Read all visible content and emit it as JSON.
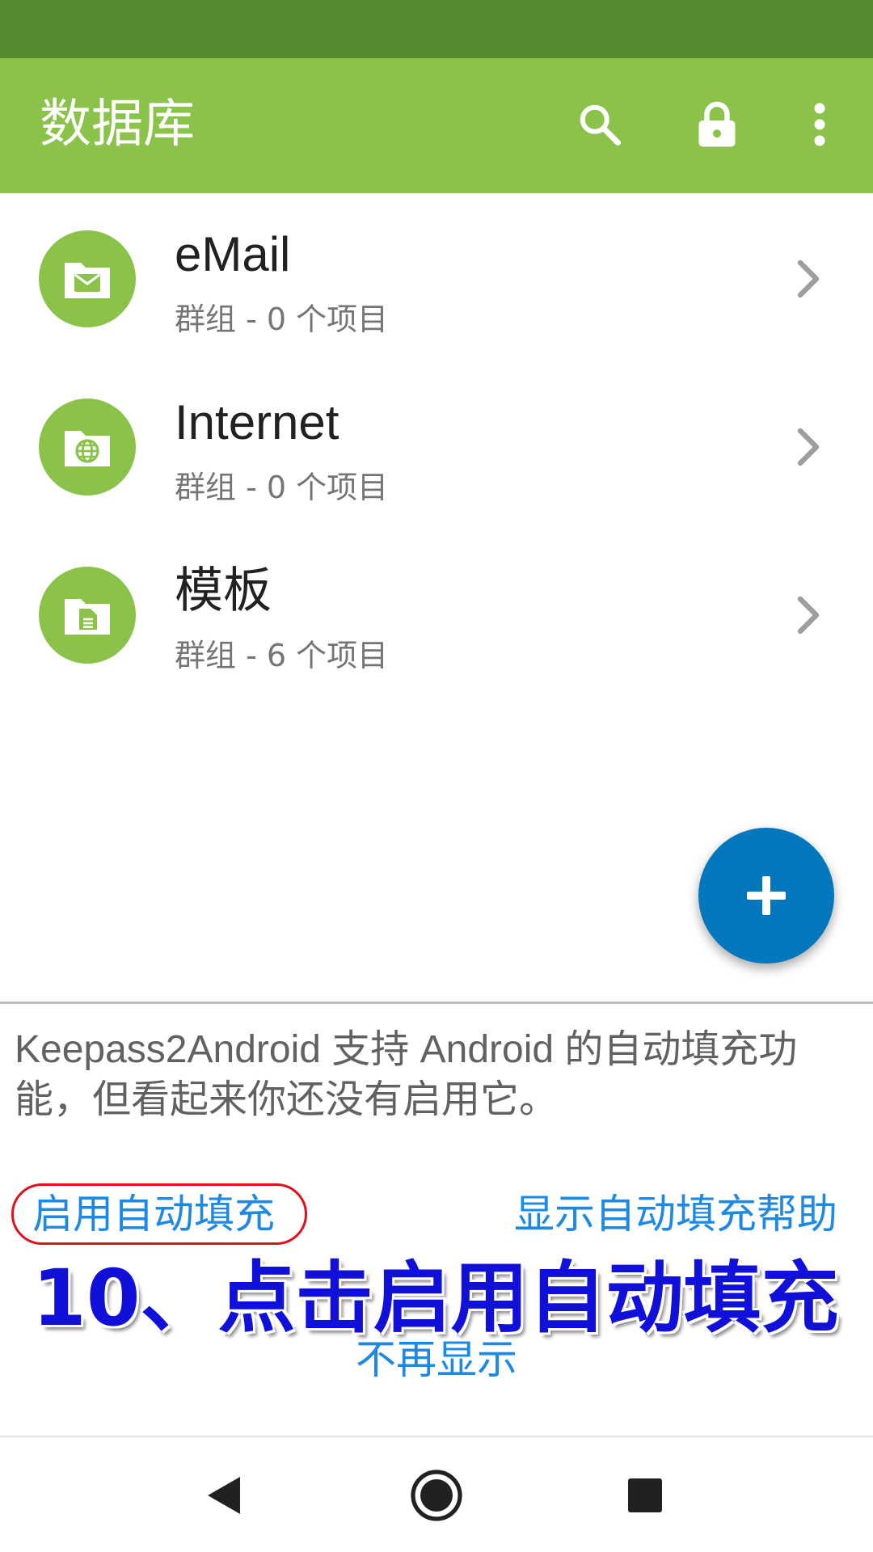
{
  "app_bar": {
    "title": "数据库",
    "actions": [
      {
        "icon": "search-icon"
      },
      {
        "icon": "lock-icon"
      },
      {
        "icon": "more-vert-icon"
      }
    ],
    "color": "#8bc34a",
    "status_bar_color": "#558b2f"
  },
  "groups": [
    {
      "name": "eMail",
      "subtitle": "群组 - 0 个项目",
      "icon": "email-folder-icon"
    },
    {
      "name": "Internet",
      "subtitle": "群组 - 0 个项目",
      "icon": "globe-folder-icon"
    },
    {
      "name": "模板",
      "subtitle": "群组 - 6 个项目",
      "icon": "document-folder-icon"
    }
  ],
  "fab": {
    "icon": "plus-icon",
    "color": "#0277bd"
  },
  "autofill_banner": {
    "message": "Keepass2Android 支持 Android 的自动填充功能，但看起来你还没有启用它。",
    "enable_label": "启用自动填充",
    "help_label": "显示自动填充帮助",
    "dismiss_label": "不再显示",
    "link_color": "#1e88e5"
  },
  "annotation": {
    "text": "10、点击启用自动填充",
    "color": "#1010d8"
  },
  "nav_bar": {
    "buttons": [
      "back-icon",
      "home-icon",
      "recents-icon"
    ]
  }
}
